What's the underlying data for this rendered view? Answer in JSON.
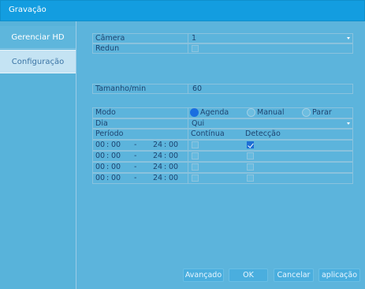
{
  "window": {
    "title": "Gravação"
  },
  "sidebar": {
    "items": [
      {
        "label": "Gerenciar HD"
      },
      {
        "label": "Configuração"
      }
    ]
  },
  "form": {
    "camera_label": "Câmera",
    "camera_value": "1",
    "redun_label": "Redun",
    "redun_checked": false,
    "size_label": "Tamanho/min",
    "size_value": "60"
  },
  "schedule": {
    "mode_label": "Modo",
    "modes": [
      {
        "label": "Agenda",
        "selected": true
      },
      {
        "label": "Manual",
        "selected": false
      },
      {
        "label": "Parar",
        "selected": false
      }
    ],
    "day_label": "Dia",
    "day_value": "Qui",
    "period_label": "Período",
    "continuous_label": "Contínua",
    "detection_label": "Detecção",
    "periods": [
      {
        "start_h": "00",
        "start_m": "00",
        "sep": "-",
        "end_h": "24",
        "end_m": "00",
        "continuous": false,
        "detection": true
      },
      {
        "start_h": "00",
        "start_m": "00",
        "sep": "-",
        "end_h": "24",
        "end_m": "00",
        "continuous": false,
        "detection": false
      },
      {
        "start_h": "00",
        "start_m": "00",
        "sep": "-",
        "end_h": "24",
        "end_m": "00",
        "continuous": false,
        "detection": false
      },
      {
        "start_h": "00",
        "start_m": "00",
        "sep": "-",
        "end_h": "24",
        "end_m": "00",
        "continuous": false,
        "detection": false
      }
    ]
  },
  "buttons": {
    "advanced": "Avançado",
    "ok": "OK",
    "cancel": "Cancelar",
    "apply": "aplicação"
  },
  "colors": {
    "title_bar": "#139de0",
    "background": "#5cb4dc",
    "accent": "#1d6fd6"
  }
}
